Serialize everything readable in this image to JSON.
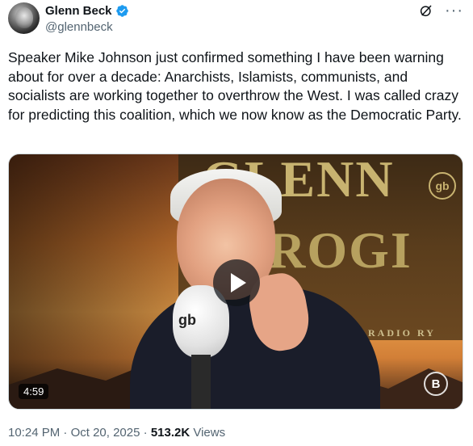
{
  "author": {
    "display_name": "Glenn Beck",
    "handle": "@glennbeck",
    "verified_icon": "verified-badge-icon"
  },
  "tweet": {
    "text": "Speaker Mike Johnson just confirmed something I have been warning about for over a decade: Anarchists, Islamists, communists, and socialists are working together to overthrow the West. I was called crazy for predicting this coalition, which we now know as the Democratic Party."
  },
  "video": {
    "duration": "4:59",
    "banner_line1": "GLENN",
    "banner_line2": "PROGI",
    "banner_sub": "RADIO   RY",
    "mic_logo": "gb",
    "corner_logo_top": "gb",
    "corner_logo_bottom": "B"
  },
  "meta": {
    "time": "10:24 PM",
    "separator": "·",
    "date": "Oct 20, 2025",
    "views_count": "513.2K",
    "views_label": "Views"
  },
  "colors": {
    "accent": "#1d9bf0",
    "text": "#0f1419",
    "secondary": "#536471"
  }
}
